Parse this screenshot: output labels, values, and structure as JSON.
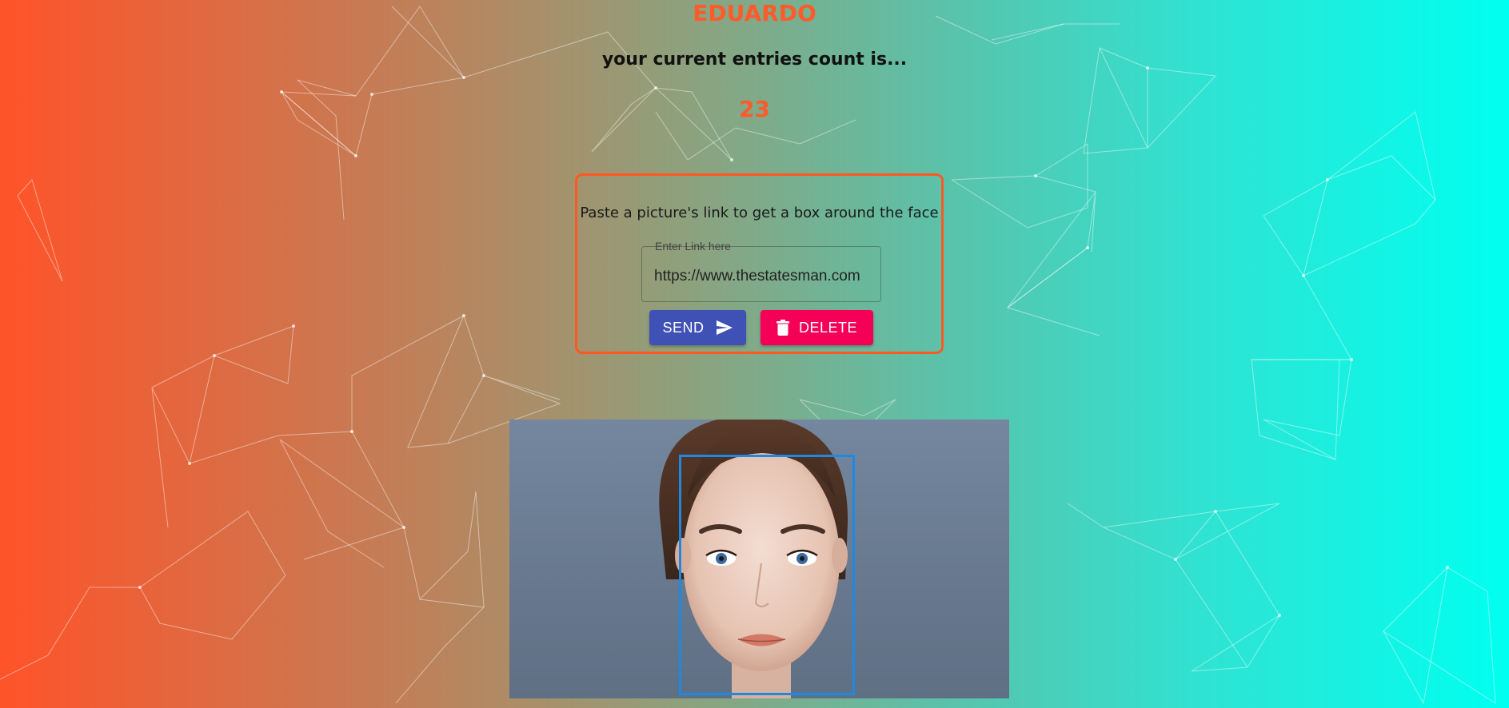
{
  "user": {
    "name": "EDUARDO"
  },
  "entries": {
    "label": "your current entries count is...",
    "count": "23"
  },
  "form": {
    "prompt": "Paste a picture's link to get a box around the face",
    "link_legend": "Enter Link here",
    "link_value": "https://www.thestatesman.com",
    "send_label": "SEND",
    "delete_label": "DELETE"
  },
  "colors": {
    "accent": "#ff5a2a",
    "send_button": "#3f51b5",
    "delete_button": "#f50057",
    "face_box": "#1e88e5"
  },
  "icons": {
    "send": "send-icon",
    "delete": "trash-icon"
  }
}
